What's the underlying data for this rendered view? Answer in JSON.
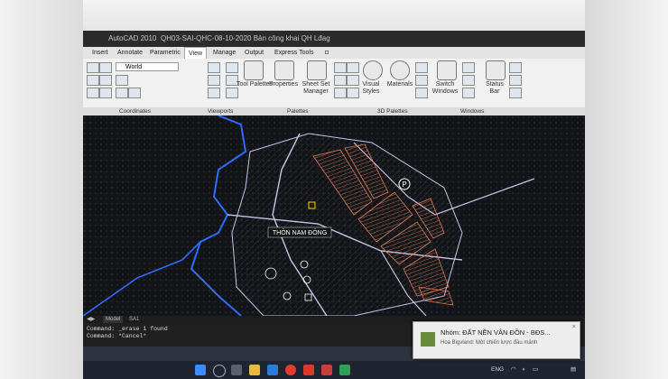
{
  "window": {
    "app_title": "AutoCAD 2010",
    "file_title": "QH03-SAI-QHC-08-10-2020 Bản công khai QH Lđag"
  },
  "menu_tabs": [
    {
      "label": "Insert",
      "active": false
    },
    {
      "label": "Annotate",
      "active": false
    },
    {
      "label": "Parametric",
      "active": false
    },
    {
      "label": "View",
      "active": true
    },
    {
      "label": "Manage",
      "active": false
    },
    {
      "label": "Output",
      "active": false
    },
    {
      "label": "Express Tools",
      "active": false
    }
  ],
  "ribbon": {
    "ucs_select": "World",
    "tool_palettes": "Tool Palettes",
    "properties": "Properties",
    "sheet_set_manager": "Sheet Set Manager",
    "visual_styles": "Visual Styles",
    "materials": "Materials",
    "switch_windows": "Switch Windows",
    "status_bar": "Status Bar"
  },
  "panels": {
    "coordinates": "Coordinates",
    "viewports": "Viewports",
    "palettes": "Palettes",
    "palettes_3d": "3D Palettes",
    "windows": "Windows"
  },
  "drawing": {
    "label": "THÔN NAM ĐÔNG",
    "parking_symbol": "P",
    "colors": {
      "background": "#121417",
      "road": "#c9c3e8",
      "lots": "#e07a55",
      "boundary": "#2f6bff"
    }
  },
  "layout_tabs": [
    "Model",
    "SA1"
  ],
  "command": {
    "line1": "Command: _erase 1 found",
    "line2": "Command: *Cancel*"
  },
  "toast": {
    "title": "Nhóm: ĐẤT NỀN VÂN ĐỒN - BĐS...",
    "body": "Hoa Bigvland: Một chiến lược đầu mảnh"
  },
  "system": {
    "language": "ENG"
  }
}
